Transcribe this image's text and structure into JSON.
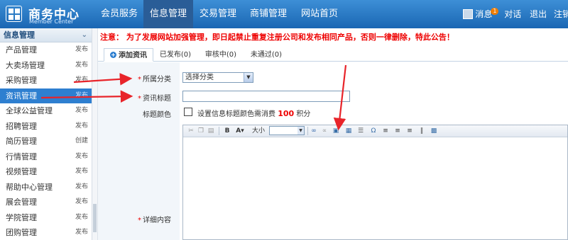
{
  "brand": {
    "title": "商务中心",
    "subtitle": "Member Center"
  },
  "nav": [
    {
      "label": "会员服务"
    },
    {
      "label": "信息管理"
    },
    {
      "label": "交易管理"
    },
    {
      "label": "商铺管理"
    },
    {
      "label": "网站首页"
    }
  ],
  "header_right": {
    "messages_label": "消息",
    "messages_count": "1",
    "chat_label": "对话",
    "logout_label": "退出",
    "register_label": "注销"
  },
  "sidebar": {
    "title": "信息管理",
    "items": [
      {
        "label": "产品管理",
        "action": "发布"
      },
      {
        "label": "大卖场管理",
        "action": "发布"
      },
      {
        "label": "采购管理",
        "action": "发布"
      },
      {
        "label": "资讯管理",
        "action": "发布"
      },
      {
        "label": "全球公益管理",
        "action": "发布"
      },
      {
        "label": "招聘管理",
        "action": "发布"
      },
      {
        "label": "简历管理",
        "action": "创建"
      },
      {
        "label": "行情管理",
        "action": "发布"
      },
      {
        "label": "视频管理",
        "action": "发布"
      },
      {
        "label": "帮助中心管理",
        "action": "发布"
      },
      {
        "label": "展会管理",
        "action": "发布"
      },
      {
        "label": "学院管理",
        "action": "发布"
      },
      {
        "label": "团购管理",
        "action": "发布"
      }
    ]
  },
  "notice": "注意： 为了发展网站加强管理，即日起禁止重复注册公司和发布相同产品，否则一律删除，特此公告！",
  "tabs": [
    {
      "label": "添加资讯"
    },
    {
      "label": "已发布(0)"
    },
    {
      "label": "审核中(0)"
    },
    {
      "label": "未通过(0)"
    }
  ],
  "form": {
    "category_label": "所属分类",
    "category_value": "选择分类",
    "title_label": "资讯标题",
    "title_value": "",
    "color_label": "标题颜色",
    "color_note_prefix": "设置信息标题颜色需消费",
    "color_note_points": "100",
    "color_note_suffix": "积分",
    "content_label": "详细内容",
    "font_size_label": "大小"
  }
}
